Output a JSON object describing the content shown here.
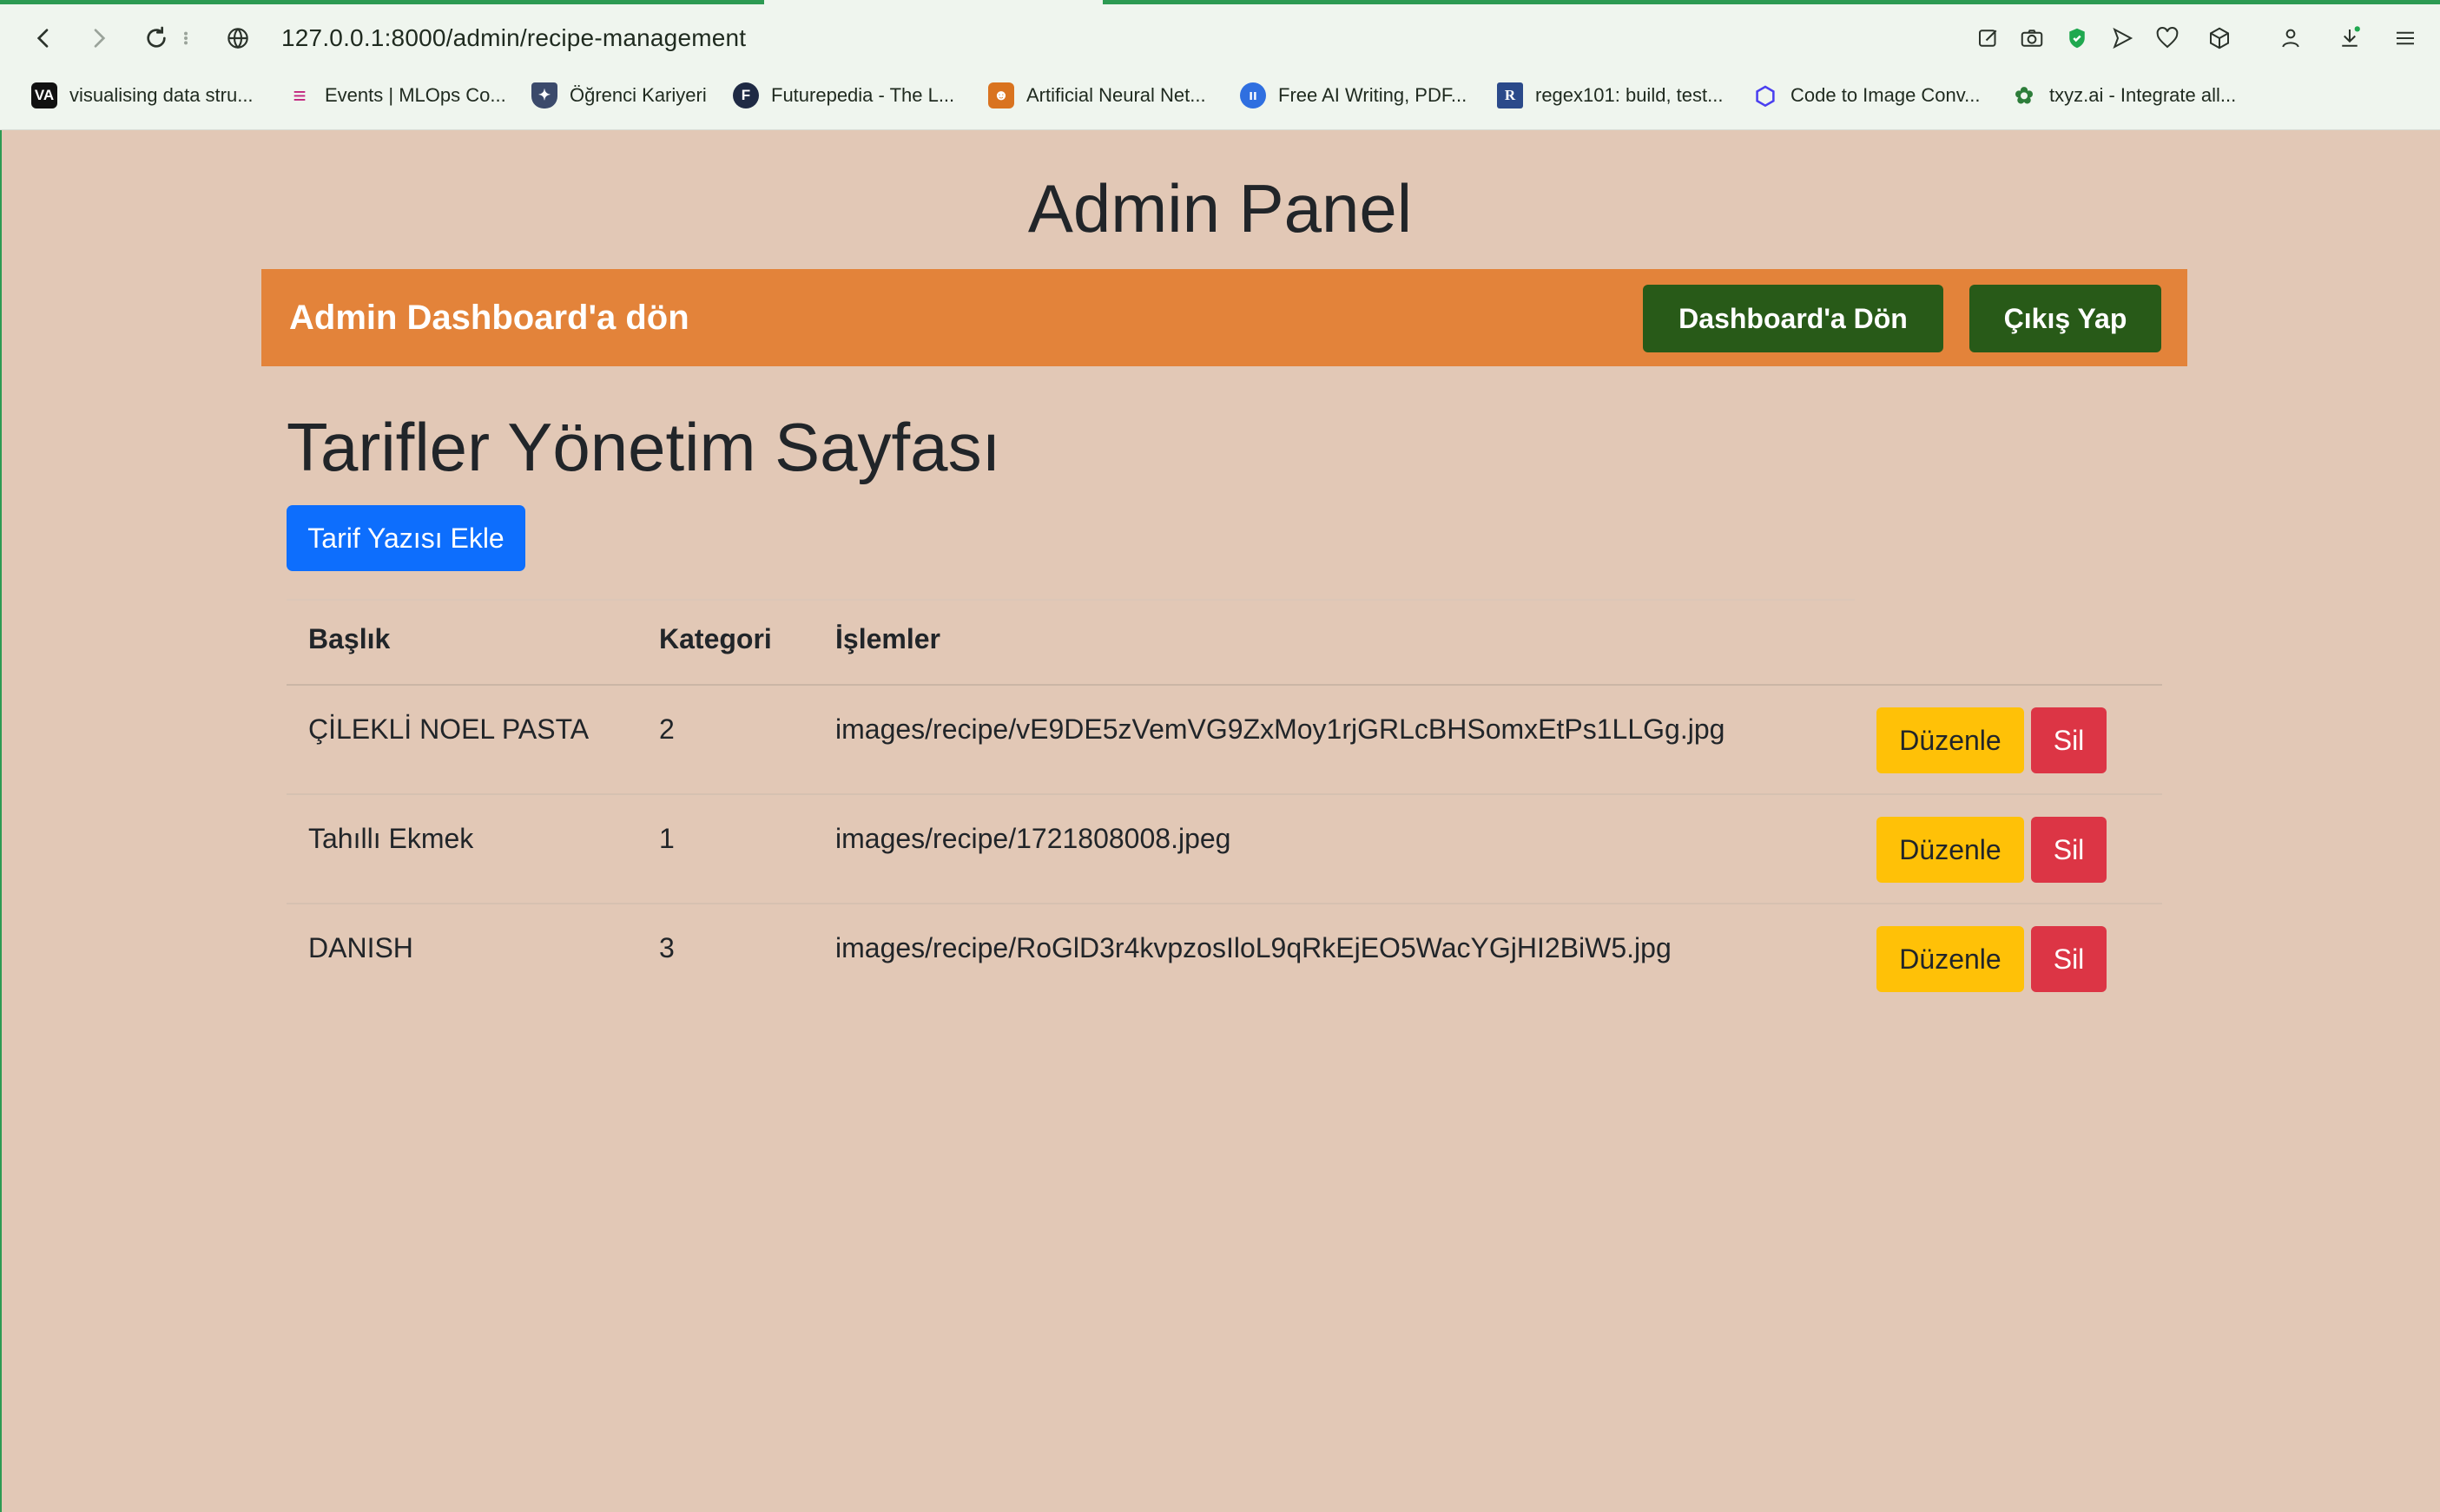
{
  "browser": {
    "url": "127.0.0.1:8000/admin/recipe-management",
    "bookmarks": [
      {
        "label": "visualising data stru...",
        "icon": "va-icon",
        "icon_text": "VA",
        "color": "#111111"
      },
      {
        "label": "Events | MLOps Co...",
        "icon": "mlops-icon",
        "icon_text": "≡",
        "color": "#c2237e"
      },
      {
        "label": "Öğrenci Kariyeri",
        "icon": "shield-icon",
        "icon_text": "✦",
        "color": "#3b4a6b"
      },
      {
        "label": "Futurepedia - The L...",
        "icon": "futurepedia-icon",
        "icon_text": "F",
        "color": "#1f2a44"
      },
      {
        "label": "Artificial Neural Net...",
        "icon": "neural-net-icon",
        "icon_text": "☻",
        "color": "#d9731f"
      },
      {
        "label": "Free AI Writing, PDF...",
        "icon": "ai-writing-icon",
        "icon_text": "ıı",
        "color": "#2f6fe0"
      },
      {
        "label": "regex101: build, test...",
        "icon": "regex101-icon",
        "icon_text": "R",
        "color": "#2b4a8a"
      },
      {
        "label": "Code to Image Conv...",
        "icon": "code-image-icon",
        "icon_text": "⬡",
        "color": "#4a3ff0"
      },
      {
        "label": "txyz.ai - Integrate all...",
        "icon": "txyz-icon",
        "icon_text": "✿",
        "color": "#2d7d3a"
      }
    ]
  },
  "header": {
    "title": "Admin Panel"
  },
  "navbar": {
    "brand": "Admin Dashboard'a dön",
    "dashboard_button": "Dashboard'a Dön",
    "logout_button": "Çıkış Yap"
  },
  "main": {
    "title": "Tarifler Yönetim Sayfası",
    "add_button": "Tarif Yazısı Ekle",
    "columns": [
      "Başlık",
      "Kategori",
      "İşlemler"
    ],
    "rows": [
      {
        "title": "ÇİLEKLİ NOEL PASTA",
        "category": "2",
        "image": "images/recipe/vE9DE5zVemVG9ZxMoy1rjGRLcBHSomxEtPs1LLGg.jpg"
      },
      {
        "title": "Tahıllı Ekmek",
        "category": "1",
        "image": "images/recipe/1721808008.jpeg"
      },
      {
        "title": "DANISH",
        "category": "3",
        "image": "images/recipe/RoGlD3r4kvpzosIloL9qRkEjEO5WacYGjHI2BiW5.jpg"
      }
    ],
    "edit_label": "Düzenle",
    "delete_label": "Sil"
  },
  "colors": {
    "page_background": "#e2c8b6",
    "navbar": "#e3833a",
    "nav_button": "#285a18",
    "primary": "#0d6efd",
    "warning": "#ffc107",
    "danger": "#dc3545"
  }
}
